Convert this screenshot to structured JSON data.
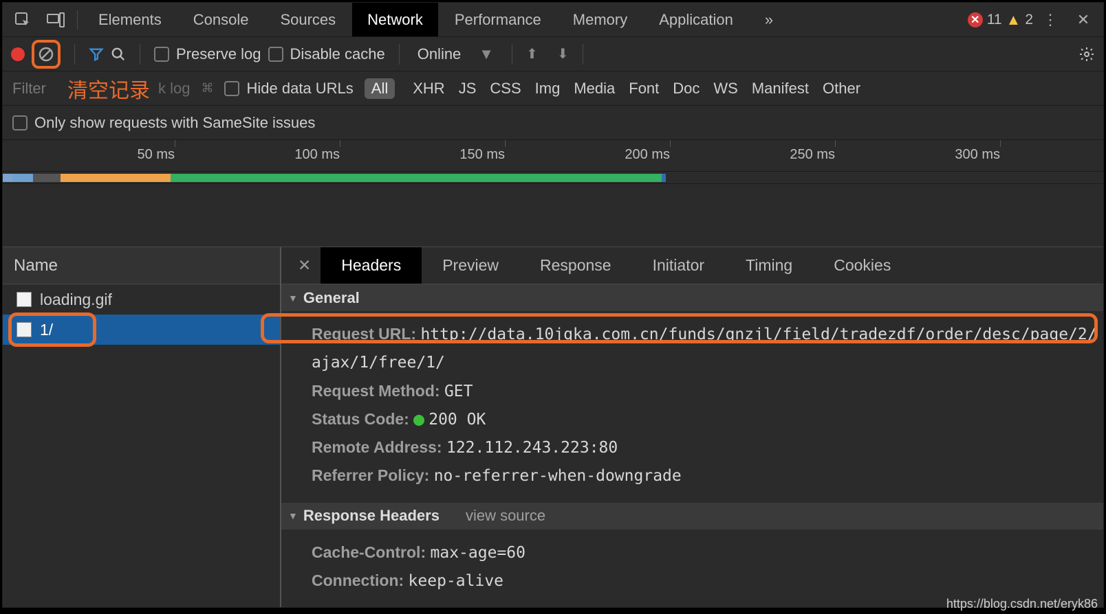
{
  "tabs": {
    "elements": "Elements",
    "console": "Console",
    "sources": "Sources",
    "network": "Network",
    "performance": "Performance",
    "memory": "Memory",
    "application": "Application",
    "more": "»"
  },
  "badges": {
    "errors": "11",
    "warnings": "2"
  },
  "toolbar": {
    "preserve_log": "Preserve log",
    "disable_cache": "Disable cache",
    "throttle": "Online"
  },
  "annotation": {
    "clear_label": "清空记录"
  },
  "filter": {
    "placeholder": "Filter",
    "grey_suffix": "k log",
    "hide_data_urls": "Hide data URLs",
    "chip_all": "All",
    "types": [
      "XHR",
      "JS",
      "CSS",
      "Img",
      "Media",
      "Font",
      "Doc",
      "WS",
      "Manifest",
      "Other"
    ]
  },
  "samesite": {
    "label": "Only show requests with SameSite issues"
  },
  "timeline": {
    "ticks": [
      "50 ms",
      "100 ms",
      "150 ms",
      "200 ms",
      "250 ms",
      "300 ms"
    ]
  },
  "requests": {
    "col_name": "Name",
    "items": [
      {
        "name": "loading.gif"
      },
      {
        "name": "1/"
      }
    ]
  },
  "detail_tabs": {
    "headers": "Headers",
    "preview": "Preview",
    "response": "Response",
    "initiator": "Initiator",
    "timing": "Timing",
    "cookies": "Cookies"
  },
  "sections": {
    "general": "General",
    "response_headers": "Response Headers",
    "view_source": "view source"
  },
  "general": {
    "request_url_label": "Request URL:",
    "request_url_value": "http://data.10jqka.com.cn/funds/gnzjl/field/tradezdf/order/desc/page/2/ajax/1/free/1/",
    "request_method_label": "Request Method:",
    "request_method_value": "GET",
    "status_code_label": "Status Code:",
    "status_code_value": "200 OK",
    "remote_address_label": "Remote Address:",
    "remote_address_value": "122.112.243.223:80",
    "referrer_policy_label": "Referrer Policy:",
    "referrer_policy_value": "no-referrer-when-downgrade"
  },
  "response_headers": {
    "cache_control_label": "Cache-Control:",
    "cache_control_value": "max-age=60",
    "connection_label": "Connection:",
    "connection_value": "keep-alive"
  },
  "watermark": "https://blog.csdn.net/eryk86"
}
